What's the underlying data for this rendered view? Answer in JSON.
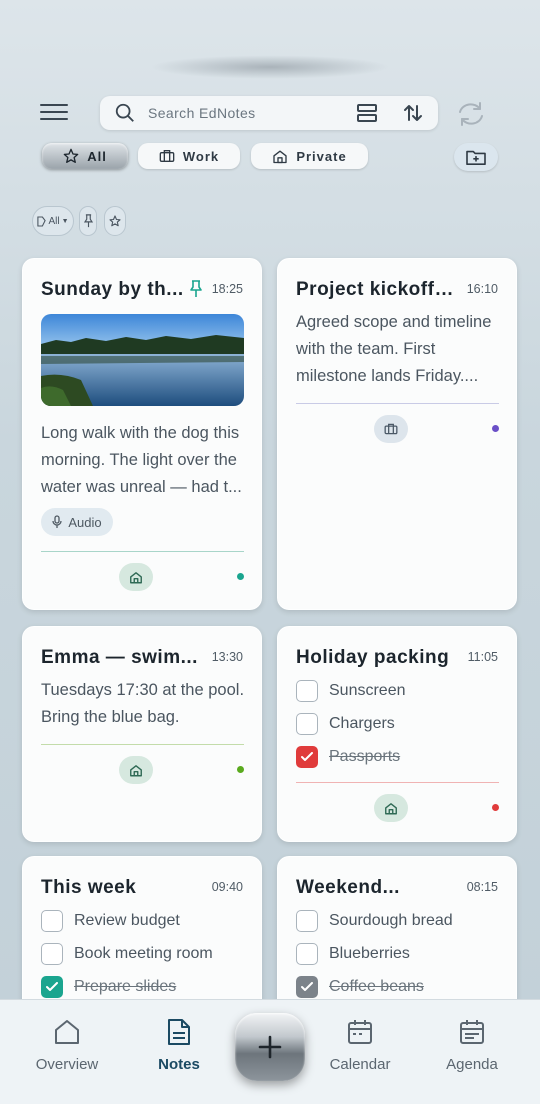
{
  "header": {
    "menu_icon": "hamburger-icon",
    "search_placeholder": "Search EdNotes",
    "view_icon": "view-toggle-icon",
    "sort_icon": "sort-icon",
    "sync_icon": "sync-icon"
  },
  "tabs": [
    {
      "label": "All",
      "icon": "star-icon",
      "active": true
    },
    {
      "label": "Work",
      "icon": "briefcase-icon",
      "active": false
    },
    {
      "label": "Private",
      "icon": "home-icon",
      "active": false
    }
  ],
  "filters": {
    "tag_label": "All",
    "pin_icon": "pin-icon",
    "star_icon": "star-icon"
  },
  "notes": [
    {
      "title": "Sunday by th...",
      "time": "18:25",
      "pinned": true,
      "has_photo": true,
      "body": "Long walk with the dog this morning. The light over the water was unreal — had t...",
      "attachment": "Audio",
      "category": "home",
      "color": "#1aa58f"
    },
    {
      "title": "Project kickoff ...",
      "time": "16:10",
      "body": "Agreed scope and timeline with the team. First milestone lands Friday....",
      "category": "work",
      "color": "#6a4fc7"
    },
    {
      "title": "Emma — swim...",
      "time": "13:30",
      "body": "Tuesdays 17:30 at the pool. Bring the blue bag.",
      "category": "home",
      "color": "#5aaa1e"
    },
    {
      "title": "Holiday packing",
      "time": "11:05",
      "items": [
        {
          "label": "Sunscreen",
          "done": false
        },
        {
          "label": "Chargers",
          "done": false
        },
        {
          "label": "Passports",
          "done": true
        }
      ],
      "category": "home",
      "color": "#e03b3b"
    },
    {
      "title": "This week",
      "time": "09:40",
      "items": [
        {
          "label": "Review budget",
          "done": false
        },
        {
          "label": "Book meeting room",
          "done": false
        },
        {
          "label": "Prepare slides",
          "done": true
        }
      ],
      "color": "#1aa58f"
    },
    {
      "title": "Weekend...",
      "time": "08:15",
      "items": [
        {
          "label": "Sourdough bread",
          "done": false
        },
        {
          "label": "Blueberries",
          "done": false
        },
        {
          "label": "Coffee beans",
          "done": true
        }
      ],
      "color": "#7c838a"
    }
  ],
  "bottom_nav": {
    "overview": "Overview",
    "notes": "Notes",
    "calendar": "Calendar",
    "agenda": "Agenda",
    "add_icon": "plus-icon"
  }
}
